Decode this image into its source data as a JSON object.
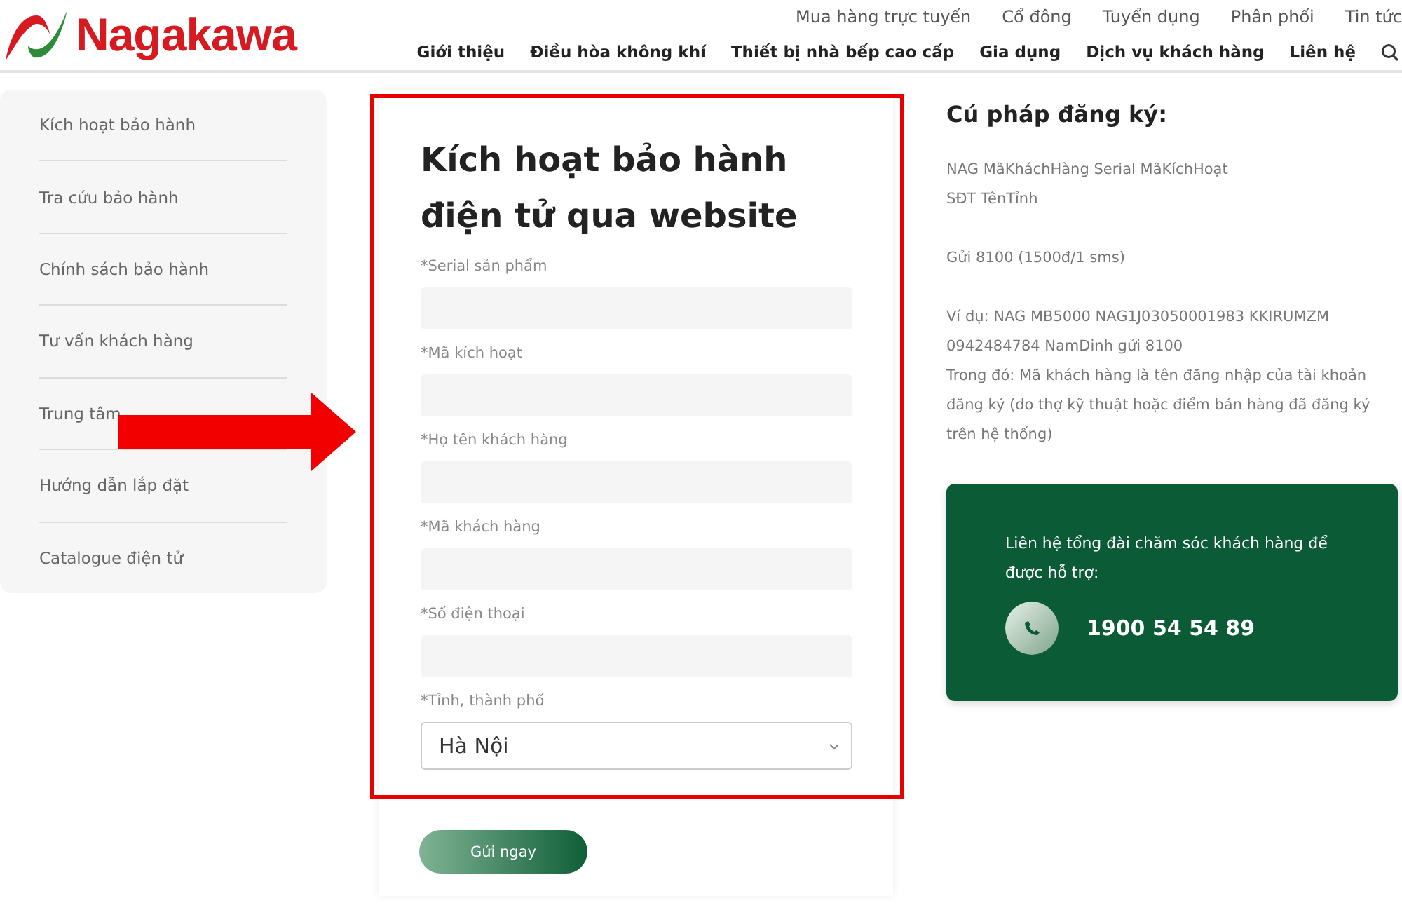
{
  "header": {
    "logo_text": "Nagakawa",
    "top_links": [
      "Mua hàng trực tuyến",
      "Cổ đông",
      "Tuyển dụng",
      "Phân phối",
      "Tin tức"
    ],
    "main_nav": [
      "Giới thiệu",
      "Điều hòa không khí",
      "Thiết bị nhà bếp cao cấp",
      "Gia dụng",
      "Dịch vụ khách hàng",
      "Liên hệ"
    ]
  },
  "sidebar": {
    "items": [
      {
        "label": "Kích hoạt bảo hành"
      },
      {
        "label": "Tra cứu bảo hành"
      },
      {
        "label": "Chính sách bảo hành"
      },
      {
        "label": "Tư vấn khách hàng"
      },
      {
        "label": "Trung tâm"
      },
      {
        "label": "Hướng dẫn lắp đặt"
      },
      {
        "label": "Catalogue điện tử"
      }
    ]
  },
  "form": {
    "title": "Kích hoạt bảo hành điện tử qua website",
    "fields": [
      {
        "kind": "text",
        "label": "*Serial sản phẩm"
      },
      {
        "kind": "text",
        "label": "*Mã kích hoạt"
      },
      {
        "kind": "text",
        "label": "*Họ tên khách hàng"
      },
      {
        "kind": "text",
        "label": "*Mã khách hàng"
      },
      {
        "kind": "text",
        "label": "*Số điện thoại"
      },
      {
        "kind": "select",
        "label": "*Tỉnh, thành phố",
        "value": "Hà Nội"
      }
    ],
    "submit": "Gửi ngay"
  },
  "syntax": {
    "heading": "Cú pháp đăng ký:",
    "paragraphs": [
      [
        "NAG MãKháchHàng Serial MãKíchHoạt",
        "SĐT TênTỉnh"
      ],
      [
        "Gửi 8100 (1500đ/1 sms)"
      ],
      [
        "Ví dụ: NAG MB5000 NAG1J03050001983 KKIRUMZM",
        "0942484784 NamDinh gửi 8100",
        "Trong đó: Mã khách hàng là tên đăng nhập của tài khoản đăng ký (do thợ kỹ thuật hoặc điểm bán hàng đã đăng ký trên hệ thống)"
      ]
    ]
  },
  "support": {
    "text": "Liên hệ tổng đài chăm sóc khách hàng để được hỗ trợ:",
    "phone": "1900 54 54 89"
  }
}
